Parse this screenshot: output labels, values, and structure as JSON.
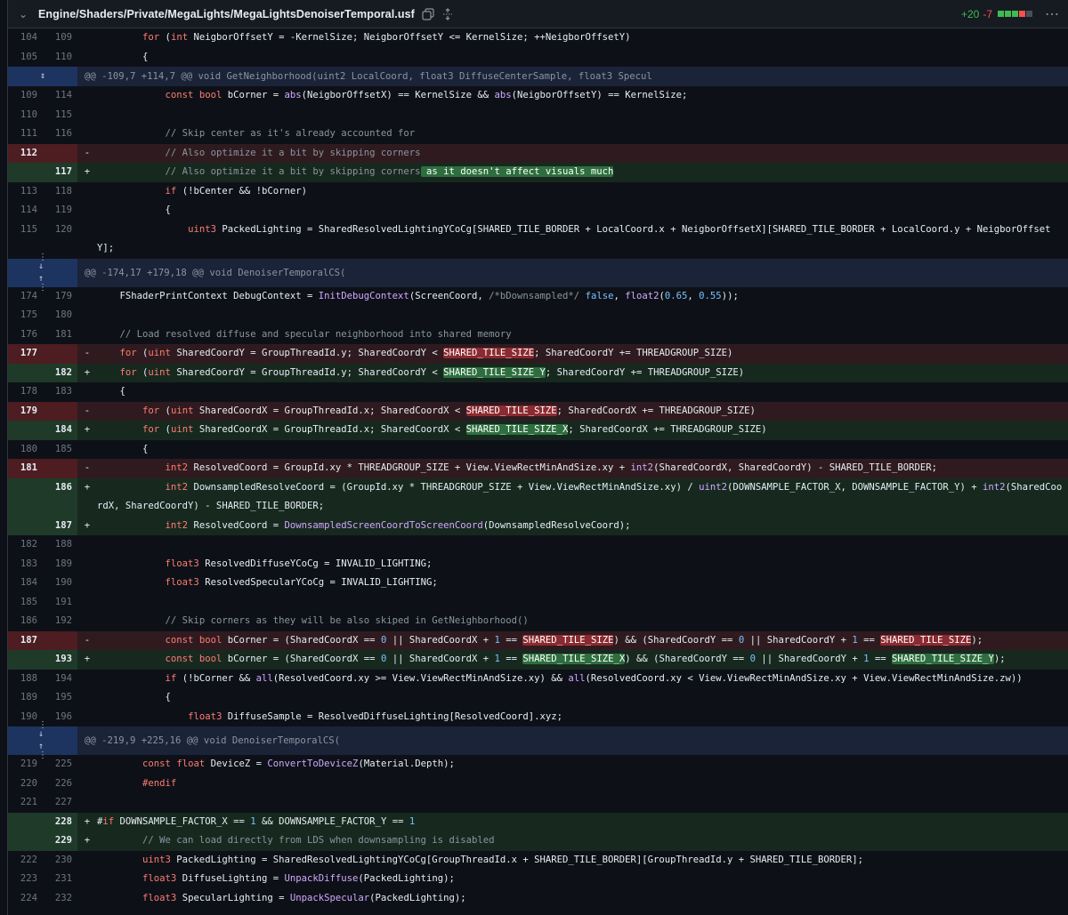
{
  "file": {
    "path": "Engine/Shaders/Private/MegaLights/MegaLightsDenoiserTemporal.usf",
    "additions": "+20",
    "deletions": "-7",
    "copy_icon": "copy-icon",
    "expand_icon": "expand-icon",
    "menu_icon": "kebab-icon",
    "colors": {
      "add": "#3fb950",
      "del": "#f85149",
      "bg": "#0d1117"
    }
  },
  "rows": [
    {
      "type": "ctx",
      "old": "104",
      "new": "109",
      "sign": "",
      "code": "        for (int NeigborOffsetY = -KernelSize; NeigborOffsetY <= KernelSize; ++NeigborOffsetY)"
    },
    {
      "type": "ctx",
      "old": "105",
      "new": "110",
      "sign": "",
      "code": "        {"
    },
    {
      "type": "hunk",
      "small": true,
      "code": "@@ -109,7 +114,7 @@ void GetNeighborhood(uint2 LocalCoord, float3 DiffuseCenterSample, float3 Specul"
    },
    {
      "type": "ctx",
      "old": "109",
      "new": "114",
      "sign": "",
      "code": "            const bool bCorner = abs(NeigborOffsetX) == KernelSize && abs(NeigborOffsetY) == KernelSize;"
    },
    {
      "type": "ctx",
      "old": "110",
      "new": "115",
      "sign": "",
      "code": ""
    },
    {
      "type": "ctx",
      "old": "111",
      "new": "116",
      "sign": "",
      "code": "            // Skip center as it's already accounted for"
    },
    {
      "type": "del",
      "old": "112",
      "new": "",
      "sign": "-",
      "code": "            // Also optimize it a bit by skipping corners"
    },
    {
      "type": "add",
      "old": "",
      "new": "117",
      "sign": "+",
      "code": "            // Also optimize it a bit by skipping corners as it doesn't affect visuals much"
    },
    {
      "type": "ctx",
      "old": "113",
      "new": "118",
      "sign": "",
      "code": "            if (!bCenter && !bCorner)"
    },
    {
      "type": "ctx",
      "old": "114",
      "new": "119",
      "sign": "",
      "code": "            {"
    },
    {
      "type": "ctx",
      "old": "115",
      "new": "120",
      "sign": "",
      "code": "                uint3 PackedLighting = SharedResolvedLightingYCoCg[SHARED_TILE_BORDER + LocalCoord.x + NeigborOffsetX][SHARED_TILE_BORDER + LocalCoord.y + NeigborOffsetY];"
    },
    {
      "type": "hunk",
      "small": false,
      "code": "@@ -174,17 +179,18 @@ void DenoiserTemporalCS("
    },
    {
      "type": "ctx",
      "old": "174",
      "new": "179",
      "sign": "",
      "code": "    FShaderPrintContext DebugContext = InitDebugContext(ScreenCoord, /*bDownsampled*/ false, float2(0.65, 0.55));"
    },
    {
      "type": "ctx",
      "old": "175",
      "new": "180",
      "sign": "",
      "code": ""
    },
    {
      "type": "ctx",
      "old": "176",
      "new": "181",
      "sign": "",
      "code": "    // Load resolved diffuse and specular neighborhood into shared memory"
    },
    {
      "type": "del",
      "old": "177",
      "new": "",
      "sign": "-",
      "code": "    for (uint SharedCoordY = GroupThreadId.y; SharedCoordY < SHARED_TILE_SIZE; SharedCoordY += THREADGROUP_SIZE)"
    },
    {
      "type": "add",
      "old": "",
      "new": "182",
      "sign": "+",
      "code": "    for (uint SharedCoordY = GroupThreadId.y; SharedCoordY < SHARED_TILE_SIZE_Y; SharedCoordY += THREADGROUP_SIZE)"
    },
    {
      "type": "ctx",
      "old": "178",
      "new": "183",
      "sign": "",
      "code": "    {"
    },
    {
      "type": "del",
      "old": "179",
      "new": "",
      "sign": "-",
      "code": "        for (uint SharedCoordX = GroupThreadId.x; SharedCoordX < SHARED_TILE_SIZE; SharedCoordX += THREADGROUP_SIZE)"
    },
    {
      "type": "add",
      "old": "",
      "new": "184",
      "sign": "+",
      "code": "        for (uint SharedCoordX = GroupThreadId.x; SharedCoordX < SHARED_TILE_SIZE_X; SharedCoordX += THREADGROUP_SIZE)"
    },
    {
      "type": "ctx",
      "old": "180",
      "new": "185",
      "sign": "",
      "code": "        {"
    },
    {
      "type": "del",
      "old": "181",
      "new": "",
      "sign": "-",
      "code": "            int2 ResolvedCoord = GroupId.xy * THREADGROUP_SIZE + View.ViewRectMinAndSize.xy + int2(SharedCoordX, SharedCoordY) - SHARED_TILE_BORDER;"
    },
    {
      "type": "add",
      "old": "",
      "new": "186",
      "sign": "+",
      "code": "            int2 DownsampledResolveCoord = (GroupId.xy * THREADGROUP_SIZE + View.ViewRectMinAndSize.xy) / uint2(DOWNSAMPLE_FACTOR_X, DOWNSAMPLE_FACTOR_Y) + int2(SharedCoordX, SharedCoordY) - SHARED_TILE_BORDER;"
    },
    {
      "type": "add",
      "old": "",
      "new": "187",
      "sign": "+",
      "code": "            int2 ResolvedCoord = DownsampledScreenCoordToScreenCoord(DownsampledResolveCoord);"
    },
    {
      "type": "ctx",
      "old": "182",
      "new": "188",
      "sign": "",
      "code": ""
    },
    {
      "type": "ctx",
      "old": "183",
      "new": "189",
      "sign": "",
      "code": "            float3 ResolvedDiffuseYCoCg = INVALID_LIGHTING;"
    },
    {
      "type": "ctx",
      "old": "184",
      "new": "190",
      "sign": "",
      "code": "            float3 ResolvedSpecularYCoCg = INVALID_LIGHTING;"
    },
    {
      "type": "ctx",
      "old": "185",
      "new": "191",
      "sign": "",
      "code": ""
    },
    {
      "type": "ctx",
      "old": "186",
      "new": "192",
      "sign": "",
      "code": "            // Skip corners as they will be also skiped in GetNeighborhood()"
    },
    {
      "type": "del",
      "old": "187",
      "new": "",
      "sign": "-",
      "code": "            const bool bCorner = (SharedCoordX == 0 || SharedCoordX + 1 == SHARED_TILE_SIZE) && (SharedCoordY == 0 || SharedCoordY + 1 == SHARED_TILE_SIZE);"
    },
    {
      "type": "add",
      "old": "",
      "new": "193",
      "sign": "+",
      "code": "            const bool bCorner = (SharedCoordX == 0 || SharedCoordX + 1 == SHARED_TILE_SIZE_X) && (SharedCoordY == 0 || SharedCoordY + 1 == SHARED_TILE_SIZE_Y);"
    },
    {
      "type": "ctx",
      "old": "188",
      "new": "194",
      "sign": "",
      "code": "            if (!bCorner && all(ResolvedCoord.xy >= View.ViewRectMinAndSize.xy) && all(ResolvedCoord.xy < View.ViewRectMinAndSize.xy + View.ViewRectMinAndSize.zw))"
    },
    {
      "type": "ctx",
      "old": "189",
      "new": "195",
      "sign": "",
      "code": "            {"
    },
    {
      "type": "ctx",
      "old": "190",
      "new": "196",
      "sign": "",
      "code": "                float3 DiffuseSample = ResolvedDiffuseLighting[ResolvedCoord].xyz;"
    },
    {
      "type": "hunk",
      "small": false,
      "code": "@@ -219,9 +225,16 @@ void DenoiserTemporalCS("
    },
    {
      "type": "ctx",
      "old": "219",
      "new": "225",
      "sign": "",
      "code": "        const float DeviceZ = ConvertToDeviceZ(Material.Depth);"
    },
    {
      "type": "ctx",
      "old": "220",
      "new": "226",
      "sign": "",
      "code": "        #endif"
    },
    {
      "type": "ctx",
      "old": "221",
      "new": "227",
      "sign": "",
      "code": ""
    },
    {
      "type": "add",
      "old": "",
      "new": "228",
      "sign": "+",
      "code": "#if DOWNSAMPLE_FACTOR_X == 1 && DOWNSAMPLE_FACTOR_Y == 1"
    },
    {
      "type": "add",
      "old": "",
      "new": "229",
      "sign": "+",
      "code": "        // We can load directly from LDS when downsampling is disabled"
    },
    {
      "type": "ctx",
      "old": "222",
      "new": "230",
      "sign": "",
      "code": "        uint3 PackedLighting = SharedResolvedLightingYCoCg[GroupThreadId.x + SHARED_TILE_BORDER][GroupThreadId.y + SHARED_TILE_BORDER];"
    },
    {
      "type": "ctx",
      "old": "223",
      "new": "231",
      "sign": "",
      "code": "        float3 DiffuseLighting = UnpackDiffuse(PackedLighting);"
    },
    {
      "type": "ctx",
      "old": "224",
      "new": "232",
      "sign": "",
      "code": "        float3 SpecularLighting = UnpackSpecular(PackedLighting);"
    }
  ]
}
